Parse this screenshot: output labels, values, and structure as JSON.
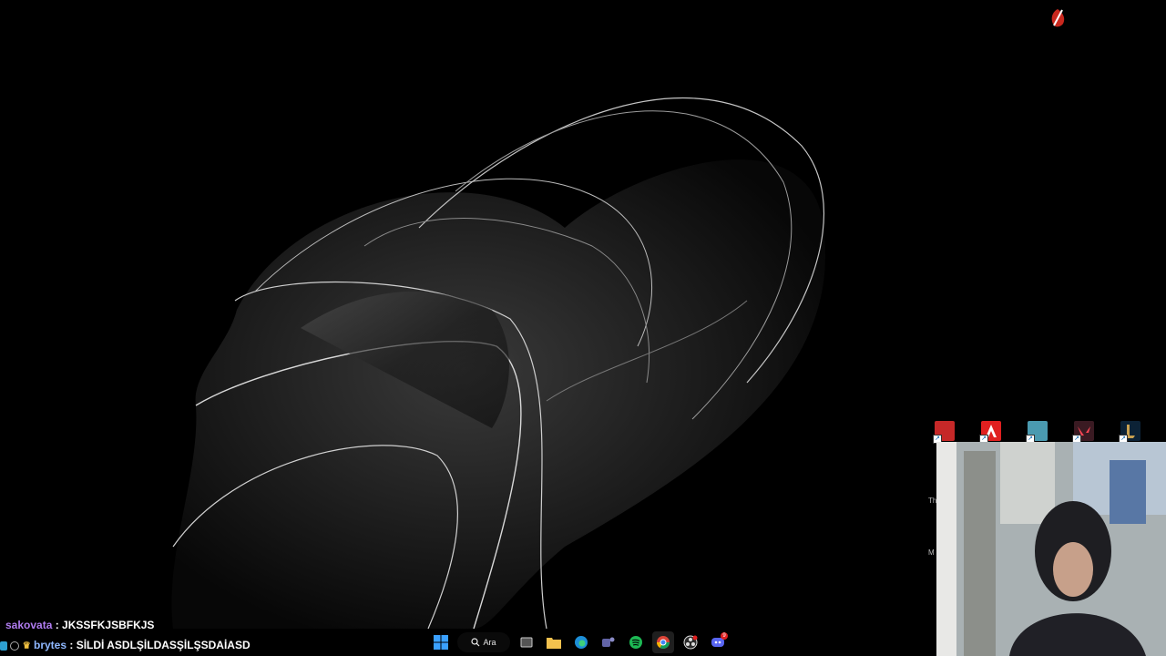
{
  "chat": [
    {
      "user": "sakovata",
      "message": "JKSSFKJSBFKJS"
    },
    {
      "user": "brytes",
      "message": "SİLDİ ASDLŞİLDASŞİLŞSDAİASD"
    }
  ],
  "taskbar": {
    "search_label": "Ara",
    "items": [
      "windows-start",
      "search",
      "task-view",
      "file-explorer",
      "edge",
      "teams",
      "spotify",
      "chrome",
      "obs",
      "discord"
    ],
    "discord_badge": "9"
  },
  "desktop_icons": [
    "app-red-icon",
    "adobe-icon",
    "landscape-app-icon",
    "valorant-icon",
    "league-of-legends-icon"
  ],
  "side_letters": [
    "Th",
    "M"
  ]
}
